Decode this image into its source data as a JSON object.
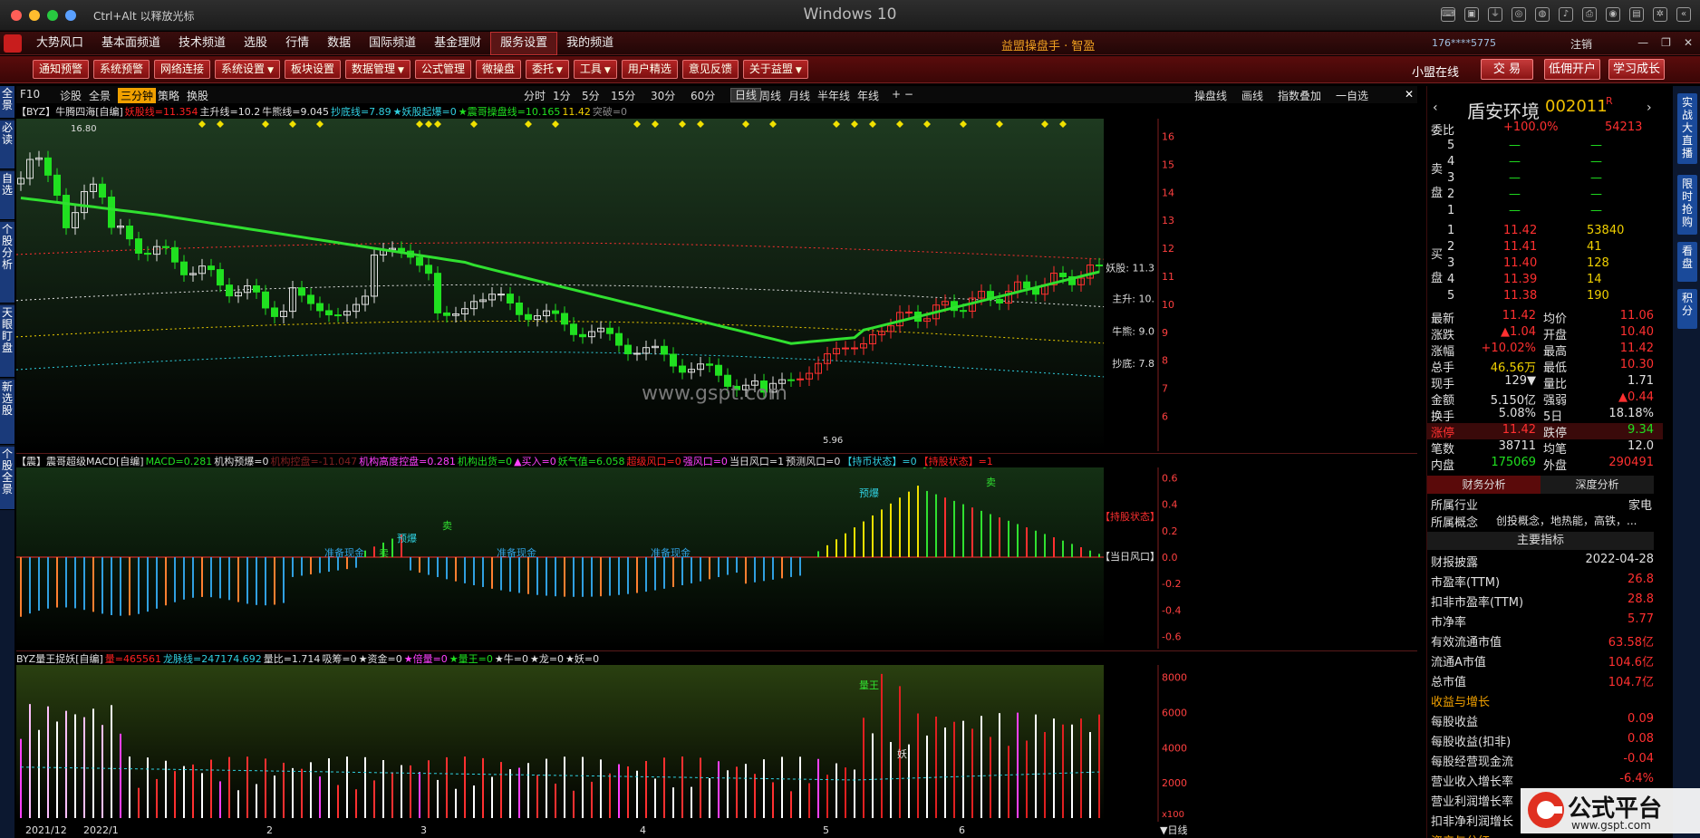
{
  "window": {
    "title": "Windows 10",
    "hint": "Ctrl+Alt 以释放光标"
  },
  "menubar": {
    "items": [
      "大势风口",
      "基本面频道",
      "技术频道",
      "选股",
      "行情",
      "数据",
      "国际频道",
      "基金理财",
      "服务设置",
      "我的频道"
    ],
    "active_index": 8,
    "brand": "益盟操盘手 · 智盈",
    "account": "176****5775",
    "logout": "注销"
  },
  "toolbar": {
    "buttons": [
      "通知预警",
      "系统预警",
      "网络连接",
      "系统设置",
      "板块设置",
      "数据管理",
      "公式管理",
      "微操盘",
      "委托",
      "工具",
      "用户精选",
      "意见反馈",
      "关于益盟"
    ],
    "dropdown_flags": [
      false,
      false,
      false,
      true,
      false,
      true,
      false,
      false,
      true,
      true,
      false,
      false,
      true
    ],
    "online": "小盟在线",
    "trade": "交 易",
    "open_account": "低佣开户",
    "learn": "学习成长"
  },
  "leftbar": [
    "全景",
    "必读",
    "自选",
    "个股分析",
    "天眼盯盘",
    "新选股",
    "个股全景"
  ],
  "farright": [
    "实战大直播",
    "限时抢购",
    "看盘",
    "积分"
  ],
  "period_bar": {
    "left_items": [
      "F10",
      "诊股",
      "全景",
      "三分钟",
      "策略",
      "换股"
    ],
    "highlight_index": 3,
    "periods": [
      "分时",
      "1分",
      "5分",
      "15分",
      "30分",
      "60分",
      "日线",
      "周线",
      "月线",
      "半年线",
      "年线"
    ],
    "active_period": "日线",
    "right_items": [
      "操盘线",
      "画线",
      "指数叠加",
      "一自选"
    ]
  },
  "main_chart": {
    "indicator_name": "【BYZ】牛腾四海[自编]",
    "params": [
      {
        "text": "妖股线=11.354",
        "color": "#ff2020"
      },
      {
        "text": "主升线=10.2",
        "color": "#e0e0e0"
      },
      {
        "text": "牛熊线=9.045",
        "color": "#e0e0e0"
      },
      {
        "text": "抄底线=7.89",
        "color": "#30d0e0"
      },
      {
        "text": "★妖股起爆=0",
        "color": "#30d0e0"
      },
      {
        "text": "★震哥操盘线=10.165",
        "color": "#20e020"
      },
      {
        "text": "11.42",
        "color": "#f0d000"
      },
      {
        "text": "突破=0",
        "color": "#888888"
      }
    ],
    "y_ticks": [
      16,
      15,
      14,
      13,
      12,
      11,
      10,
      9,
      8,
      7,
      6
    ],
    "ylim": [
      5.5,
      16.5
    ],
    "right_labels": [
      {
        "text": "妖股: 11.3",
        "value": 11.3
      },
      {
        "text": "主升: 10.",
        "value": 10.2
      },
      {
        "text": "牛熊: 9.0",
        "value": 9.045
      },
      {
        "text": "抄底: 7.8",
        "value": 7.89
      }
    ],
    "high_label": "16.80",
    "low_label": "5.96",
    "watermark": "www.gspt.com"
  },
  "macd_chart": {
    "indicator_name": "【震】震哥超级MACD[自编]",
    "params": [
      {
        "text": "MACD=0.281",
        "color": "#20e020"
      },
      {
        "text": "机构预爆=0",
        "color": "#e0e0e0"
      },
      {
        "text": "机构控盘=-11.047",
        "color": "#802020"
      },
      {
        "text": "机构高度控盘=0.281",
        "color": "#ff40ff"
      },
      {
        "text": "机构出货=0",
        "color": "#20e020"
      },
      {
        "text": "▲买入=0",
        "color": "#ff40ff"
      },
      {
        "text": "妖气值=6.058",
        "color": "#20e020"
      },
      {
        "text": "超级风口=0",
        "color": "#ff2020"
      },
      {
        "text": "强风口=0",
        "color": "#ff40ff"
      },
      {
        "text": "当日风口=1",
        "color": "#e0e0e0"
      },
      {
        "text": "预测风口=0",
        "color": "#e0e0e0"
      },
      {
        "text": "【持币状态】=0",
        "color": "#30d0e0"
      },
      {
        "text": "【持股状态】=1",
        "color": "#ff2020"
      }
    ],
    "y_ticks": [
      "0.6",
      "0.4",
      "0.2",
      "0.0",
      "-0.2",
      "-0.4",
      "-0.6"
    ],
    "ylim": [
      -0.65,
      0.65
    ],
    "labels": [
      "准备现金",
      "准备现金",
      "准备现金",
      "预爆",
      "预爆",
      "卖",
      "卖",
      "卖",
      "卖",
      "【持股状态】",
      "【当日风口】"
    ]
  },
  "vol_chart": {
    "indicator_name": "BYZ量王捉妖[自编]",
    "params": [
      {
        "text": "量=465561",
        "color": "#ff2020"
      },
      {
        "text": "龙脉线=247174.692",
        "color": "#30d0e0"
      },
      {
        "text": "量比=1.714",
        "color": "#e0e0e0"
      },
      {
        "text": "吸筹=0",
        "color": "#e0e0e0"
      },
      {
        "text": "★资金=0",
        "color": "#e0e0e0"
      },
      {
        "text": "★倍量=0",
        "color": "#ff40ff"
      },
      {
        "text": "★量王=0",
        "color": "#20e020"
      },
      {
        "text": "★牛=0",
        "color": "#e0e0e0"
      },
      {
        "text": "★龙=0",
        "color": "#e0e0e0"
      },
      {
        "text": "★妖=0",
        "color": "#e0e0e0"
      }
    ],
    "y_ticks": [
      "8000",
      "6000",
      "4000",
      "2000"
    ],
    "ylim": [
      0,
      8500
    ],
    "scale_label": "x100",
    "labels": [
      "量王",
      "妖"
    ]
  },
  "x_axis": {
    "labels": [
      "2021/12",
      "2022/1",
      "2",
      "3",
      "4",
      "5",
      "6"
    ],
    "period_label": "日线"
  },
  "quote_panel": {
    "name": "盾安环境",
    "code": "002011",
    "flag": "R",
    "weibi_label": "委比",
    "weibi": "+100.0%",
    "weicha": "54213",
    "sell_label": "卖盘",
    "buy_label": "买盘",
    "sell": [
      {
        "lvl": "5",
        "price": "—",
        "vol": "—"
      },
      {
        "lvl": "4",
        "price": "—",
        "vol": "—"
      },
      {
        "lvl": "3",
        "price": "—",
        "vol": "—"
      },
      {
        "lvl": "2",
        "price": "—",
        "vol": "—"
      },
      {
        "lvl": "1",
        "price": "—",
        "vol": "—"
      }
    ],
    "buy": [
      {
        "lvl": "1",
        "price": "11.42",
        "vol": "53840"
      },
      {
        "lvl": "2",
        "price": "11.41",
        "vol": "41"
      },
      {
        "lvl": "3",
        "price": "11.40",
        "vol": "128"
      },
      {
        "lvl": "4",
        "price": "11.39",
        "vol": "14"
      },
      {
        "lvl": "5",
        "price": "11.38",
        "vol": "190"
      }
    ],
    "stats": [
      {
        "l1": "最新",
        "v1": "11.42",
        "c1": "red",
        "l2": "均价",
        "v2": "11.06",
        "c2": "red"
      },
      {
        "l1": "涨跌",
        "v1": "▲1.04",
        "c1": "red",
        "l2": "开盘",
        "v2": "10.40",
        "c2": "red"
      },
      {
        "l1": "涨幅",
        "v1": "+10.02%",
        "c1": "red",
        "l2": "最高",
        "v2": "11.42",
        "c2": "red"
      },
      {
        "l1": "总手",
        "v1": "46.56万",
        "c1": "yellow",
        "l2": "最低",
        "v2": "10.30",
        "c2": "red"
      },
      {
        "l1": "现手",
        "v1": "129▼",
        "c1": "white",
        "l2": "量比",
        "v2": "1.71",
        "c2": "white"
      },
      {
        "l1": "金额",
        "v1": "5.150亿",
        "c1": "white",
        "l2": "强弱",
        "v2": "▲0.44",
        "c2": "red"
      },
      {
        "l1": "换手",
        "v1": "5.08%",
        "c1": "white",
        "l2": "5日",
        "v2": "18.18%",
        "c2": "white"
      },
      {
        "l1": "涨停",
        "v1": "11.42",
        "c1": "red",
        "l2": "跌停",
        "v2": "9.34",
        "c2": "green"
      },
      {
        "l1": "笔数",
        "v1": "38711",
        "c1": "white",
        "l2": "均笔",
        "v2": "12.0",
        "c2": "white"
      },
      {
        "l1": "内盘",
        "v1": "175069",
        "c1": "green",
        "l2": "外盘",
        "v2": "290491",
        "c2": "red"
      }
    ],
    "tabs": [
      "财务分析",
      "深度分析"
    ],
    "industry_label": "所属行业",
    "industry": "家电",
    "concept_label": "所属概念",
    "concept": "创投概念，地热能，高铁，...",
    "main_indicators": "主要指标",
    "fin": [
      {
        "l": "财报披露",
        "v": "2022-04-28"
      },
      {
        "l": "市盈率(TTM)",
        "v": "26.8"
      },
      {
        "l": "扣非市盈率(TTM)",
        "v": "28.8"
      },
      {
        "l": "市净率",
        "v": "5.77"
      },
      {
        "l": "有效流通市值",
        "v": "63.58亿"
      },
      {
        "l": "流通A市值",
        "v": "104.6亿"
      },
      {
        "l": "总市值",
        "v": "104.7亿"
      }
    ],
    "growth_label": "收益与增长",
    "growth": [
      {
        "l": "每股收益",
        "v": "0.09"
      },
      {
        "l": "每股收益(扣非)",
        "v": "0.08"
      },
      {
        "l": "每股经营现金流",
        "v": "-0.04"
      },
      {
        "l": "营业收入增长率",
        "v": "-6.4%"
      },
      {
        "l": "营业利润增长率",
        "v": ""
      },
      {
        "l": "扣非净利润增长",
        "v": ""
      }
    ],
    "dividend_label": "资产与分红"
  },
  "watermark_logo": {
    "text": "公式平台",
    "url": "www.gspt.com"
  }
}
